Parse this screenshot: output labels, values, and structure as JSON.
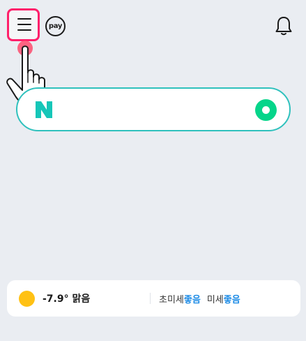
{
  "header": {
    "pay_label": "pay"
  },
  "search": {
    "logo_letter": "N"
  },
  "weather": {
    "temperature": "-7.9°",
    "condition": "맑음",
    "fine_dust_label": "초미세",
    "fine_dust_status": "좋음",
    "dust_label": "미세",
    "dust_status": "좋음"
  },
  "colors": {
    "highlight": "#ff1f6b",
    "search_border": "#2fc1bd",
    "naver_green": "#05d58a",
    "status_good": "#1e8ce6",
    "sun": "#ffc114"
  }
}
